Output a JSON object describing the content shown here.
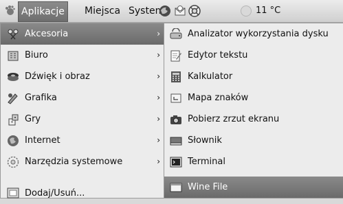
{
  "panel": {
    "applications_label": "Aplikacje",
    "places_label": "Miejsca",
    "system_label": "System",
    "weather_text": "11 °C"
  },
  "menu": {
    "categories": [
      {
        "label": "Akcesoria",
        "icon": "accessories-icon",
        "arrow": "›"
      },
      {
        "label": "Biuro",
        "icon": "office-icon",
        "arrow": "›"
      },
      {
        "label": "Dźwięk i obraz",
        "icon": "multimedia-icon",
        "arrow": "›"
      },
      {
        "label": "Grafika",
        "icon": "graphics-icon",
        "arrow": "›"
      },
      {
        "label": "Gry",
        "icon": "games-icon",
        "arrow": "›"
      },
      {
        "label": "Internet",
        "icon": "internet-icon",
        "arrow": "›"
      },
      {
        "label": "Narzędzia systemowe",
        "icon": "system-tools-icon",
        "arrow": "›"
      },
      {
        "label": "Dodaj/Usuń...",
        "icon": "add-remove-icon"
      }
    ],
    "submenu": [
      {
        "label": "Analizator wykorzystania dysku",
        "icon": "disk-usage-icon"
      },
      {
        "label": "Edytor tekstu",
        "icon": "text-editor-icon"
      },
      {
        "label": "Kalkulator",
        "icon": "calculator-icon"
      },
      {
        "label": "Mapa znaków",
        "icon": "character-map-icon"
      },
      {
        "label": "Pobierz zrzut ekranu",
        "icon": "screenshot-icon"
      },
      {
        "label": "Słownik",
        "icon": "dictionary-icon"
      },
      {
        "label": "Terminal",
        "icon": "terminal-icon"
      },
      {
        "label": "Wine File",
        "icon": "wine-file-icon"
      }
    ]
  }
}
